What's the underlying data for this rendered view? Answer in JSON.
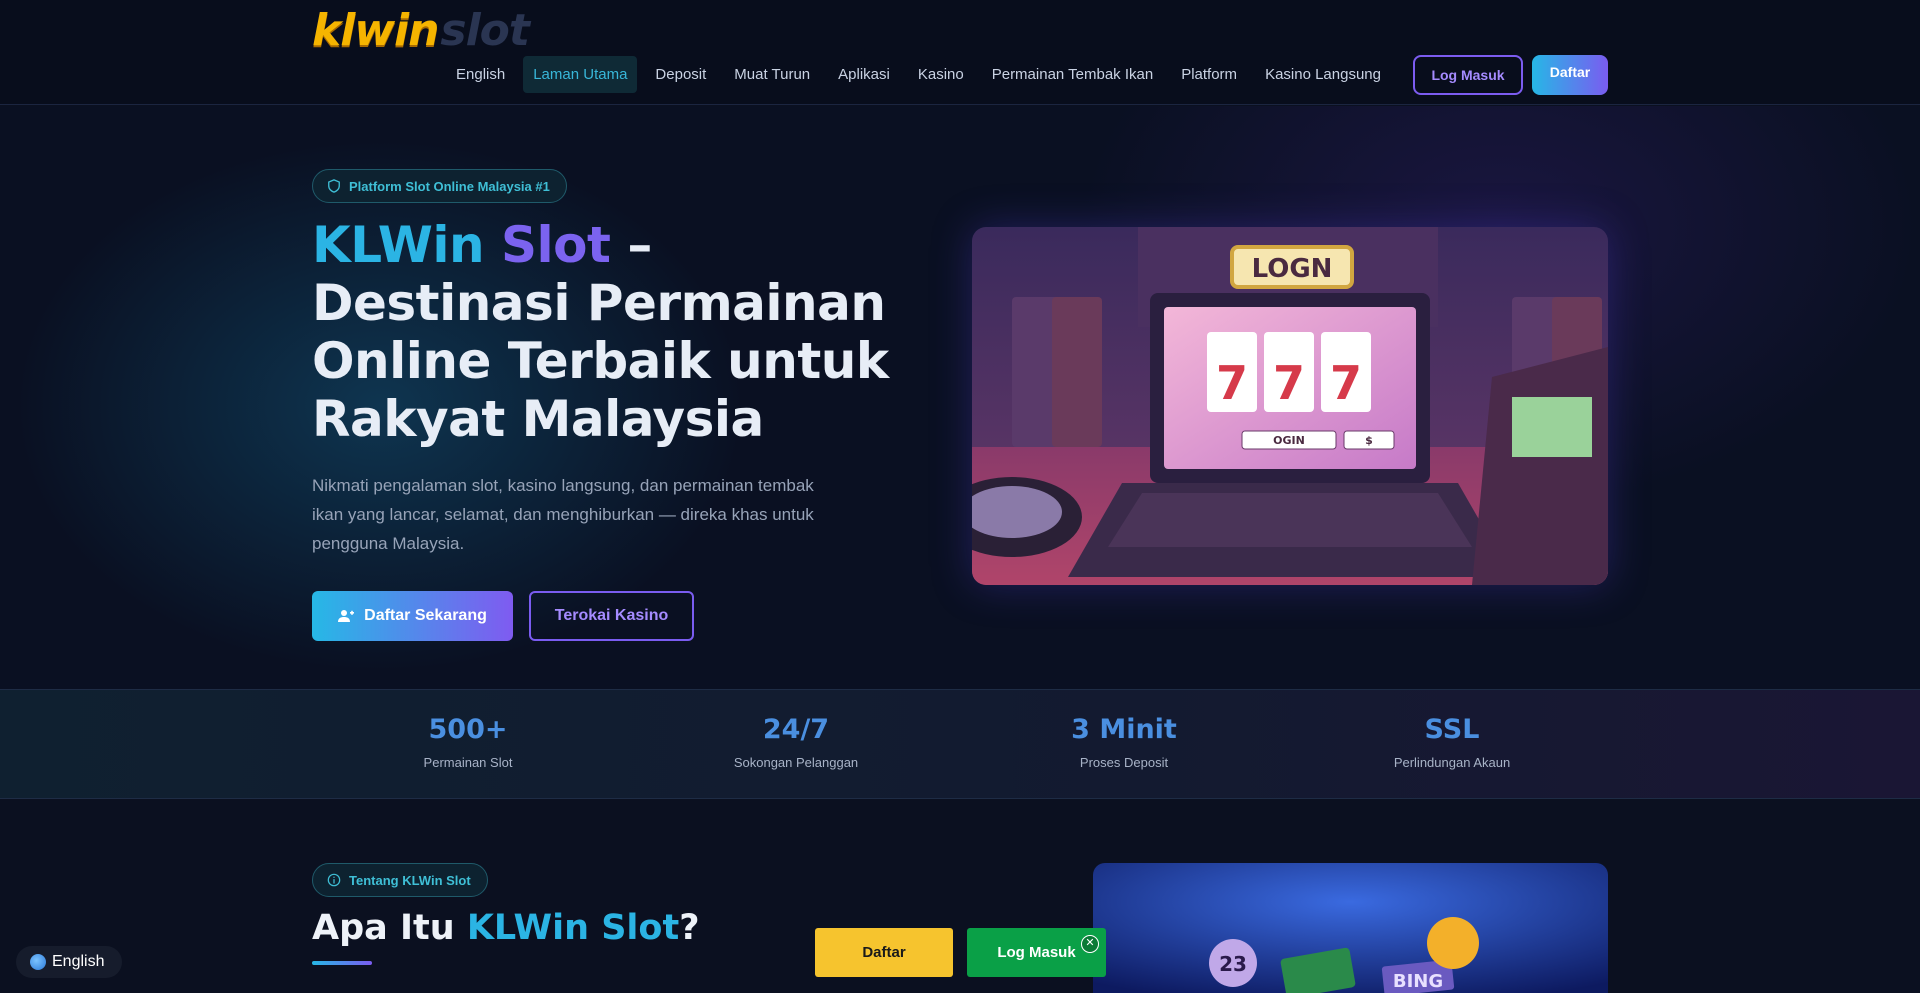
{
  "brand": {
    "logo_primary": "klwin",
    "logo_secondary": "slot"
  },
  "nav": {
    "items": [
      {
        "label": "English",
        "active": false
      },
      {
        "label": "Laman Utama",
        "active": true
      },
      {
        "label": "Deposit",
        "active": false
      },
      {
        "label": "Muat Turun",
        "active": false
      },
      {
        "label": "Aplikasi",
        "active": false
      },
      {
        "label": "Kasino",
        "active": false
      },
      {
        "label": "Permainan Tembak Ikan",
        "active": false
      },
      {
        "label": "Platform",
        "active": false
      },
      {
        "label": "Kasino Langsung",
        "active": false
      }
    ],
    "login_label": "Log Masuk",
    "register_label": "Daftar"
  },
  "hero": {
    "badge": "Platform Slot Online Malaysia #1",
    "title_part1": "KLWin ",
    "title_part2": "Slot",
    "title_rest": " – Destinasi Permainan Online Terbaik untuk Rakyat Malaysia",
    "description": "Nikmati pengalaman slot, kasino langsung, dan permainan tembak ikan yang lancar, selamat, dan menghiburkan — direka khas untuk pengguna Malaysia.",
    "primary_cta": "Daftar Sekarang",
    "secondary_cta": "Terokai Kasino",
    "image_text": {
      "sign": "LOGN",
      "screen_button": "OGIN",
      "screen_symbol": "$"
    }
  },
  "stats": [
    {
      "value": "500+",
      "label": "Permainan Slot"
    },
    {
      "value": "24/7",
      "label": "Sokongan Pelanggan"
    },
    {
      "value": "3 Minit",
      "label": "Proses Deposit"
    },
    {
      "value": "SSL",
      "label": "Perlindungan Akaun"
    }
  ],
  "about": {
    "badge": "Tentang KLWin Slot",
    "title_part1": "Apa Itu ",
    "title_highlight": "KLWin Slot",
    "title_end": "?",
    "image_text": {
      "ball": "23",
      "sign": "BING"
    }
  },
  "floating": {
    "language": "English",
    "sticky_register": "Daftar",
    "sticky_login": "Log Masuk",
    "close_glyph": "✕"
  },
  "colors": {
    "accent_cyan": "#26b7e6",
    "accent_purple": "#7a5cf0",
    "stat_blue": "#4a8fe0",
    "sticky_yellow": "#f6c42e",
    "sticky_green": "#0aa047"
  }
}
